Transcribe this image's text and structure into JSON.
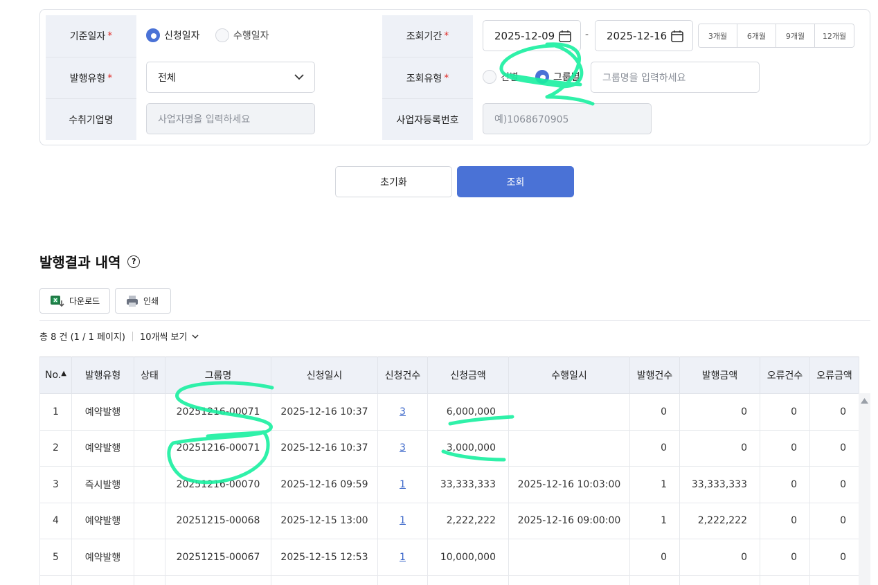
{
  "filters": {
    "base_date_label": "기준일자",
    "base_date_options": [
      "신청일자",
      "수행일자"
    ],
    "issue_type_label": "발행유형",
    "issue_type_value": "전체",
    "recipient_label": "수취기업명",
    "recipient_placeholder": "사업자명을 입력하세요",
    "period_label": "조회기간",
    "date_from": "2025-12-09",
    "date_sep": "-",
    "date_to": "2025-12-16",
    "period_buttons": [
      "3개월",
      "6개월",
      "9개월",
      "12개월"
    ],
    "query_type_label": "조회유형",
    "query_type_options": [
      "건별",
      "그룹별"
    ],
    "group_placeholder": "그룹명을 입력하세요",
    "bizno_label": "사업자등록번호",
    "bizno_placeholder": "예)1068670905",
    "required_mark": "*"
  },
  "actions": {
    "reset": "초기화",
    "search": "조회"
  },
  "results": {
    "title": "발행결과 내역",
    "help_icon": "?",
    "download": "다운로드",
    "print": "인쇄",
    "total_text": "총 8 건 (1 / 1 페이지)",
    "per_page": "10개씩 보기",
    "columns": [
      "No.",
      "발행유형",
      "상태",
      "그룹명",
      "신청일시",
      "신청건수",
      "신청금액",
      "수행일시",
      "발행건수",
      "발행금액",
      "오류건수",
      "오류금액"
    ],
    "rows": [
      {
        "no": "1",
        "type": "예약발행",
        "status": "",
        "group": "20251216-00071",
        "req_time": "2025-12-16 10:37",
        "req_count": "3",
        "req_amount": "6,000,000",
        "exec_time": "",
        "issue_count": "0",
        "issue_amount": "0",
        "err_count": "0",
        "err_amount": "0"
      },
      {
        "no": "2",
        "type": "예약발행",
        "status": "",
        "group": "20251216-00071",
        "req_time": "2025-12-16 10:37",
        "req_count": "3",
        "req_amount": "3,000,000",
        "exec_time": "",
        "issue_count": "0",
        "issue_amount": "0",
        "err_count": "0",
        "err_amount": "0"
      },
      {
        "no": "3",
        "type": "즉시발행",
        "status": "",
        "group": "20251216-00070",
        "req_time": "2025-12-16 09:59",
        "req_count": "1",
        "req_amount": "33,333,333",
        "exec_time": "2025-12-16 10:03:00",
        "issue_count": "1",
        "issue_amount": "33,333,333",
        "err_count": "0",
        "err_amount": "0"
      },
      {
        "no": "4",
        "type": "예약발행",
        "status": "",
        "group": "20251215-00068",
        "req_time": "2025-12-15 13:00",
        "req_count": "1",
        "req_amount": "2,222,222",
        "exec_time": "2025-12-16 09:00:00",
        "issue_count": "1",
        "issue_amount": "2,222,222",
        "err_count": "0",
        "err_amount": "0"
      },
      {
        "no": "5",
        "type": "예약발행",
        "status": "",
        "group": "20251215-00067",
        "req_time": "2025-12-15 12:53",
        "req_count": "1",
        "req_amount": "10,000,000",
        "exec_time": "",
        "issue_count": "0",
        "issue_amount": "0",
        "err_count": "0",
        "err_amount": "0"
      }
    ]
  },
  "colors": {
    "accent": "#4a72d6",
    "required": "#e0302c",
    "label_bg": "#eef1f7",
    "annotation": "#18f0a0"
  }
}
